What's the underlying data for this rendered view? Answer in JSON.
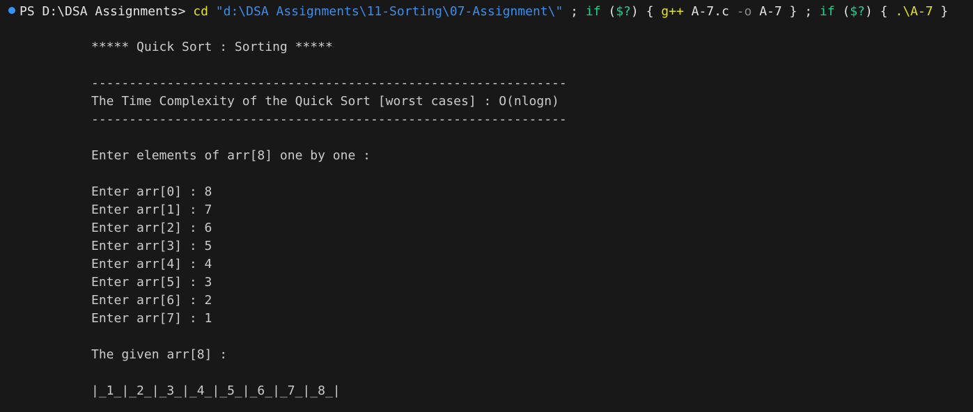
{
  "colors": {
    "background": "#181818",
    "text": "#cccccc",
    "prompt_dot": "#3794ff",
    "command": "#e5e510",
    "string": "#3b8eea",
    "keyword": "#23d18b",
    "flag": "#8a8a8a"
  },
  "prompt": {
    "dot_icon": "circle-dot-icon",
    "ps": "PS D:\\DSA Assignments>",
    "cmd": "cd",
    "path": "\"d:\\DSA Assignments\\11-Sorting\\07-Assignment\\\"",
    "sep1": ";",
    "if1": "if",
    "cond1_open": "(",
    "cond1_var": "$?",
    "cond1_close": ")",
    "brace1_open": "{",
    "gpp": "g++",
    "src": "A-7.c",
    "flag": "-o",
    "out": "A-7",
    "brace1_close": "}",
    "sep2": ";",
    "if2": "if",
    "cond2_open": "(",
    "cond2_var": "$?",
    "cond2_close": ")",
    "brace2_open": "{",
    "exe": ".\\A-7",
    "brace2_close": "}"
  },
  "output": {
    "title": "***** Quick Sort : Sorting *****",
    "divider": "---------------------------------------------------------------",
    "complexity": "The Time Complexity of the Quick Sort [worst cases] : O(nlogn)",
    "enter_prompt": "Enter elements of arr[8] one by one :",
    "entries": [
      "Enter arr[0] : 8",
      "Enter arr[1] : 7",
      "Enter arr[2] : 6",
      "Enter arr[3] : 5",
      "Enter arr[4] : 4",
      "Enter arr[5] : 3",
      "Enter arr[6] : 2",
      "Enter arr[7] : 1"
    ],
    "given_label": "The given arr[8] :",
    "array_display": "|_1_|_2_|_3_|_4_|_5_|_6_|_7_|_8_|"
  }
}
